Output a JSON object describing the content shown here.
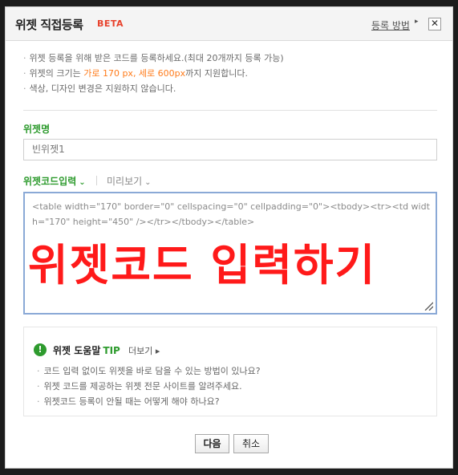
{
  "window": {
    "title": "위젯 직접등록",
    "badge": "BETA",
    "help_link": "등록 방법",
    "help_arrow": "▸",
    "close_label": "✕"
  },
  "notes": [
    {
      "bullet": "·",
      "before": "위젯 등록을 위해 받은 코드를 등록하세요.(최대 20개까지 등록 가능)",
      "highlight": "",
      "after": ""
    },
    {
      "bullet": "·",
      "before": "위젯의 크기는 ",
      "highlight": "가로 170 px, 세로 600px",
      "after": "까지 지원합니다."
    },
    {
      "bullet": "·",
      "before": "색상, 디자인 변경은 지원하지 않습니다.",
      "highlight": "",
      "after": ""
    }
  ],
  "name_field": {
    "label": "위젯명",
    "value": "빈위젯1"
  },
  "tabs": {
    "code": "위젯코드입력",
    "code_chevron": "⌄",
    "preview": "미리보기",
    "preview_chevron": "⌄"
  },
  "code_input": {
    "value": "<table width=\"170\" border=\"0\" cellspacing=\"0\" cellpadding=\"0\"><tbody><tr><td width=\"170\" height=\"450\" /></tr></tbody></table>",
    "overlay_text": "위젯코드 입력하기"
  },
  "tip": {
    "icon": "!",
    "title": "위젯 도움말",
    "title_accent": "TIP",
    "more": "더보기 ▸",
    "items": [
      "코드 입력 없이도 위젯을 바로 담을 수 있는 방법이 있나요?",
      "위젯 코드를 제공하는 위젯 전문 사이트를 알려주세요.",
      "위젯코드 등록이 안될 때는 어떻게 해야 하나요?"
    ],
    "bullet": "·"
  },
  "buttons": {
    "next": "다음",
    "cancel": "취소"
  },
  "colors": {
    "accent_green": "#2e9b2e",
    "beta_red": "#e8422c",
    "highlight_orange": "#ff7b1a",
    "overlay_red": "#ff1a1a",
    "focus_border": "#8aa9d6"
  }
}
